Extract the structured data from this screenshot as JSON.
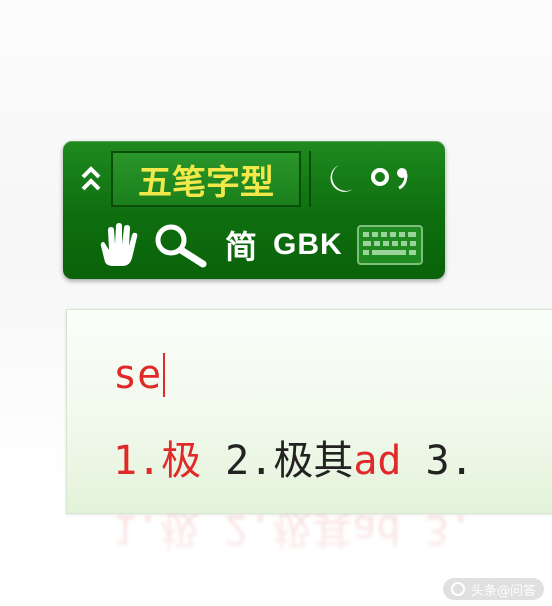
{
  "ime_toolbar": {
    "collapse_glyph": "⌃",
    "mode_label": "五笔字型",
    "punctuation_glyph": "○,",
    "script_label": "简",
    "charset_label": "GBK",
    "icons": [
      "double-chevron-up-icon",
      "moon-icon",
      "punctuation-icon",
      "hand-icon",
      "search-icon",
      "keyboard-icon"
    ],
    "colors": {
      "bar": "#0e6e0e",
      "mode_text": "#f2e84a",
      "icon": "#ffffff"
    }
  },
  "candidate_window": {
    "composition": "se",
    "candidates": [
      {
        "num": "1.",
        "word": "极",
        "code": ""
      },
      {
        "num": "2.",
        "word": "极其",
        "code": "ad"
      },
      {
        "num": "3.",
        "word": "",
        "code": ""
      }
    ],
    "colors": {
      "highlight": "#e02a2a",
      "text": "#222222"
    }
  },
  "watermark": {
    "text": "头条@问答"
  }
}
